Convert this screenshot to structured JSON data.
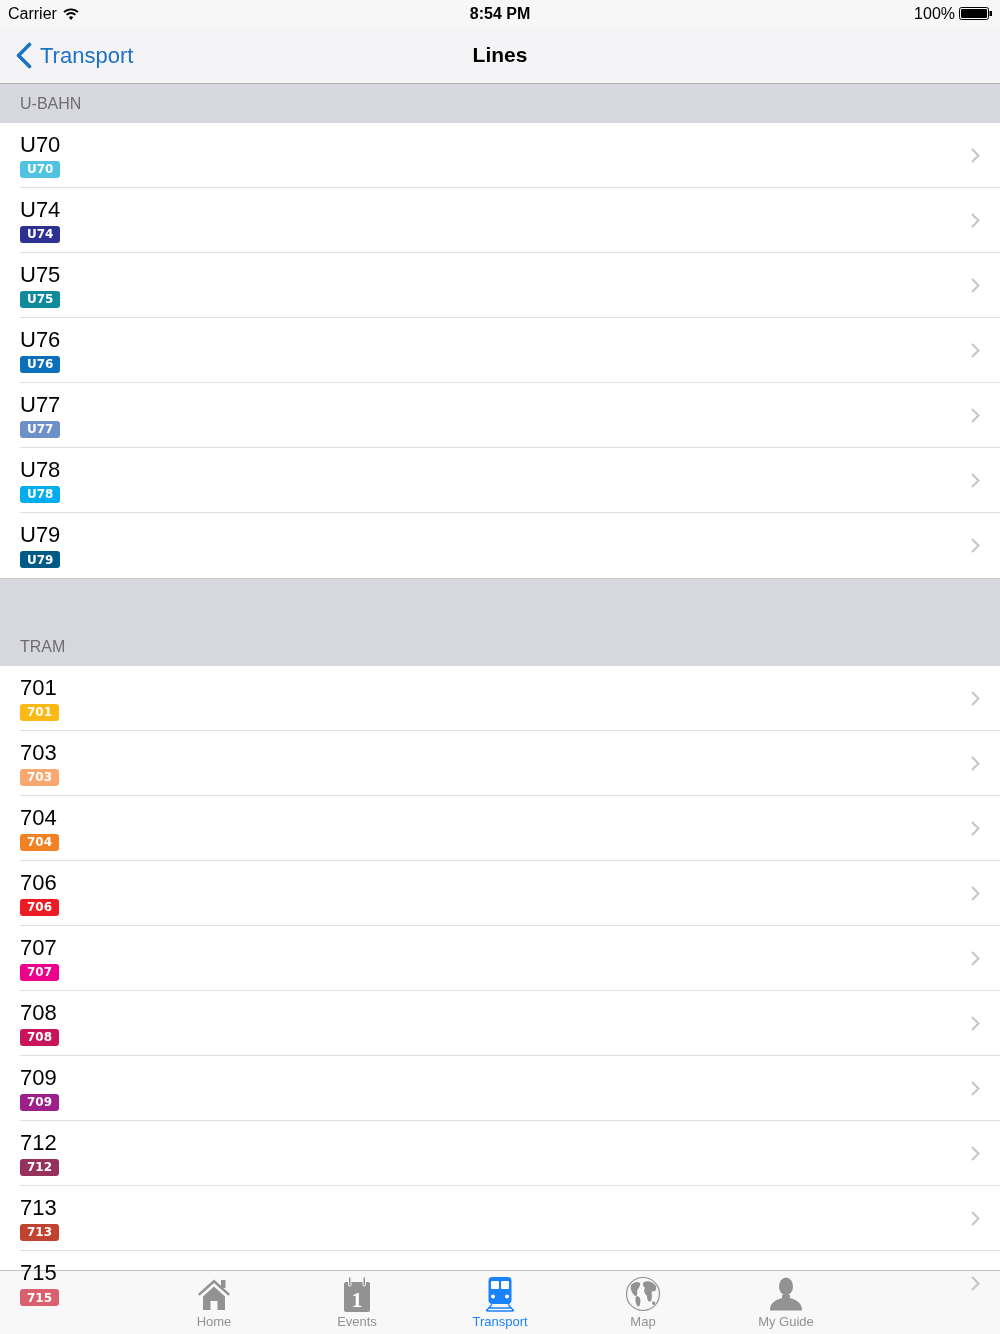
{
  "status_bar": {
    "carrier": "Carrier",
    "time": "8:54 PM",
    "battery": "100%"
  },
  "nav_bar": {
    "back_label": "Transport",
    "title": "Lines"
  },
  "sections": [
    {
      "title": "U-BAHN",
      "rows": [
        {
          "name": "U70",
          "badge": "U70",
          "color": "#4fc3df"
        },
        {
          "name": "U74",
          "badge": "U74",
          "color": "#2e3192"
        },
        {
          "name": "U75",
          "badge": "U75",
          "color": "#0f8a9d"
        },
        {
          "name": "U76",
          "badge": "U76",
          "color": "#0b6fba"
        },
        {
          "name": "U77",
          "badge": "U77",
          "color": "#6f8fc8"
        },
        {
          "name": "U78",
          "badge": "U78",
          "color": "#00aeef"
        },
        {
          "name": "U79",
          "badge": "U79",
          "color": "#005a86"
        }
      ]
    },
    {
      "title": "TRAM",
      "rows": [
        {
          "name": "701",
          "badge": "701",
          "color": "#fdb913"
        },
        {
          "name": "703",
          "badge": "703",
          "color": "#f9a870"
        },
        {
          "name": "704",
          "badge": "704",
          "color": "#f28123"
        },
        {
          "name": "706",
          "badge": "706",
          "color": "#ed1c24"
        },
        {
          "name": "707",
          "badge": "707",
          "color": "#ec008c"
        },
        {
          "name": "708",
          "badge": "708",
          "color": "#c9145a"
        },
        {
          "name": "709",
          "badge": "709",
          "color": "#9c1f8a"
        },
        {
          "name": "712",
          "badge": "712",
          "color": "#96315b"
        },
        {
          "name": "713",
          "badge": "713",
          "color": "#c1422e"
        },
        {
          "name": "715",
          "badge": "715",
          "color": "#d9606e"
        }
      ]
    }
  ],
  "tab_bar": [
    {
      "label": "Home",
      "kind": "home",
      "selected": false
    },
    {
      "label": "Events",
      "kind": "calendar",
      "icon_text": "1",
      "selected": false
    },
    {
      "label": "Transport",
      "kind": "train",
      "selected": true
    },
    {
      "label": "Map",
      "kind": "globe",
      "selected": false
    },
    {
      "label": "My Guide",
      "kind": "person",
      "selected": false
    }
  ]
}
